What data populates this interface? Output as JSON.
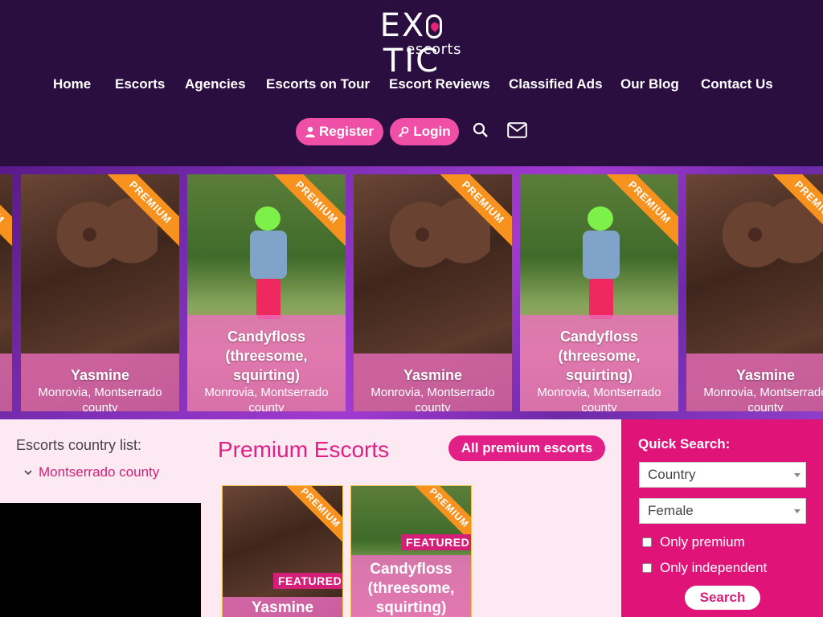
{
  "logo": {
    "line1": "EX",
    "line1b": "TIC",
    "line2": "escorts"
  },
  "nav": [
    "Home",
    "Escorts",
    "Agencies",
    "Escorts on Tour",
    "Escort Reviews",
    "Classified Ads",
    "Our Blog",
    "Contact Us"
  ],
  "actions": {
    "register": "Register",
    "login": "Login",
    "search_icon": "search-icon",
    "mail_icon": "mail-icon"
  },
  "carousel": {
    "ribbon": "PREMIUM",
    "cards": [
      {
        "name": "Yasmine",
        "location": "Monrovia, Montserrado county"
      },
      {
        "name": "Candyfloss (threesome, squirting)",
        "location": "Monrovia, Montserrado county"
      }
    ]
  },
  "sidebar": {
    "title": "Escorts country list:",
    "item": "Montserrado county"
  },
  "premium": {
    "heading": "Premium Escorts",
    "all_button": "All premium escorts",
    "featured_label": "FEATURED",
    "ribbon": "PREMIUM",
    "cards": [
      {
        "name": "Yasmine"
      },
      {
        "name": "Candyfloss (threesome, squirting)"
      }
    ]
  },
  "quick_search": {
    "title": "Quick Search:",
    "country": "Country",
    "gender": "Female",
    "only_premium": "Only premium",
    "only_independent": "Only independent",
    "search": "Search"
  },
  "colors": {
    "header_bg": "#2a0e3f",
    "accent": "#e01478",
    "pill": "#ef4fa6",
    "ribbon": "#f7921e"
  }
}
